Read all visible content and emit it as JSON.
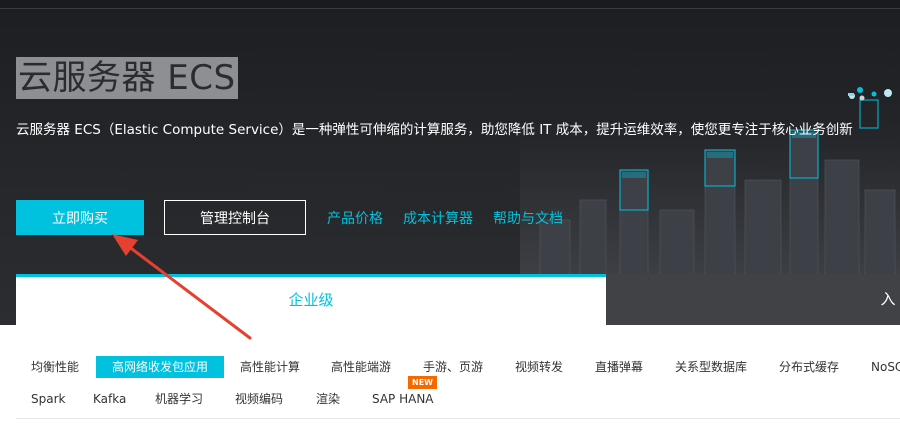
{
  "hero": {
    "title": "云服务器 ECS",
    "description": "云服务器 ECS（Elastic Compute Service）是一种弹性可伸缩的计算服务，助您降低 IT 成本，提升运维效率，使您更专注于核心业务创新",
    "buy_button": "立即购买",
    "console_button": "管理控制台",
    "links": [
      "产品价格",
      "成本计算器",
      "帮助与文档"
    ]
  },
  "tabs": {
    "enterprise": "企业级",
    "entry": "入门"
  },
  "scenarios": {
    "row1": [
      "均衡性能",
      "高网络收发包应用",
      "高性能计算",
      "高性能端游",
      "手游、页游",
      "视频转发",
      "直播弹幕",
      "关系型数据库",
      "分布式缓存",
      "NoSQ"
    ],
    "row2": [
      "Spark",
      "Kafka",
      "机器学习",
      "视频编码",
      "渲染",
      "SAP HANA"
    ],
    "selected": "高网络收发包应用",
    "new_badge": "NEW"
  },
  "colors": {
    "accent": "#00c1de",
    "hero_bg": "#25272b",
    "annotation_arrow": "#e8402e",
    "badge": "#f56a00"
  }
}
